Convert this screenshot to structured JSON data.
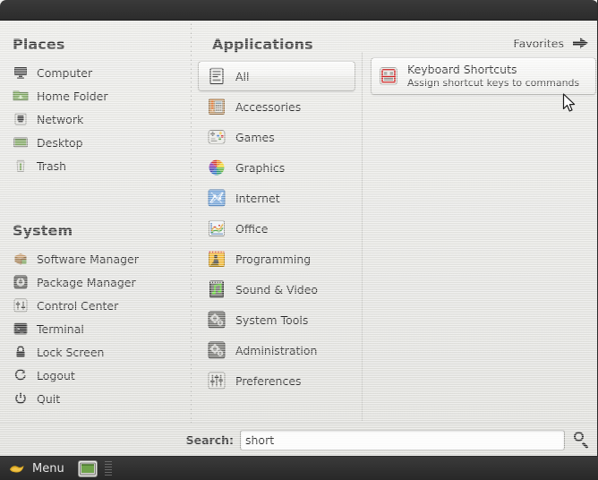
{
  "window": {
    "accent_dark": "#2f2f2f",
    "background": "#e4e4e1"
  },
  "places": {
    "title": "Places",
    "items": [
      {
        "label": "Computer",
        "icon": "computer-icon"
      },
      {
        "label": "Home Folder",
        "icon": "home-folder-icon"
      },
      {
        "label": "Network",
        "icon": "network-icon"
      },
      {
        "label": "Desktop",
        "icon": "desktop-icon"
      },
      {
        "label": "Trash",
        "icon": "trash-icon"
      }
    ]
  },
  "system": {
    "title": "System",
    "items": [
      {
        "label": "Software Manager",
        "icon": "software-manager-icon"
      },
      {
        "label": "Package Manager",
        "icon": "package-manager-icon"
      },
      {
        "label": "Control Center",
        "icon": "control-center-icon"
      },
      {
        "label": "Terminal",
        "icon": "terminal-icon"
      },
      {
        "label": "Lock Screen",
        "icon": "lock-icon"
      },
      {
        "label": "Logout",
        "icon": "logout-icon"
      },
      {
        "label": "Quit",
        "icon": "power-icon"
      }
    ]
  },
  "applications": {
    "title": "Applications",
    "selected": "All",
    "categories": [
      {
        "label": "All",
        "icon": "all-categories-icon"
      },
      {
        "label": "Accessories",
        "icon": "accessories-icon"
      },
      {
        "label": "Games",
        "icon": "games-icon"
      },
      {
        "label": "Graphics",
        "icon": "graphics-icon"
      },
      {
        "label": "Internet",
        "icon": "internet-icon"
      },
      {
        "label": "Office",
        "icon": "office-icon"
      },
      {
        "label": "Programming",
        "icon": "programming-icon"
      },
      {
        "label": "Sound & Video",
        "icon": "sound-video-icon"
      },
      {
        "label": "System Tools",
        "icon": "system-tools-icon"
      },
      {
        "label": "Administration",
        "icon": "administration-icon"
      },
      {
        "label": "Preferences",
        "icon": "preferences-icon"
      }
    ]
  },
  "results": {
    "favorites_label": "Favorites",
    "favorites_arrow_icon": "arrow-right-icon",
    "items": [
      {
        "title": "Keyboard Shortcuts",
        "description": "Assign shortcut keys to commands",
        "icon": "keyboard-shortcuts-icon"
      }
    ]
  },
  "search": {
    "label": "Search:",
    "value": "short",
    "placeholder": "",
    "icon": "search-icon"
  },
  "panel": {
    "menu_button_label": "Menu",
    "menu_button_icon": "mint-leaf-icon",
    "show_desktop_icon": "show-desktop-icon",
    "grip_icon": "panel-grip-icon"
  }
}
